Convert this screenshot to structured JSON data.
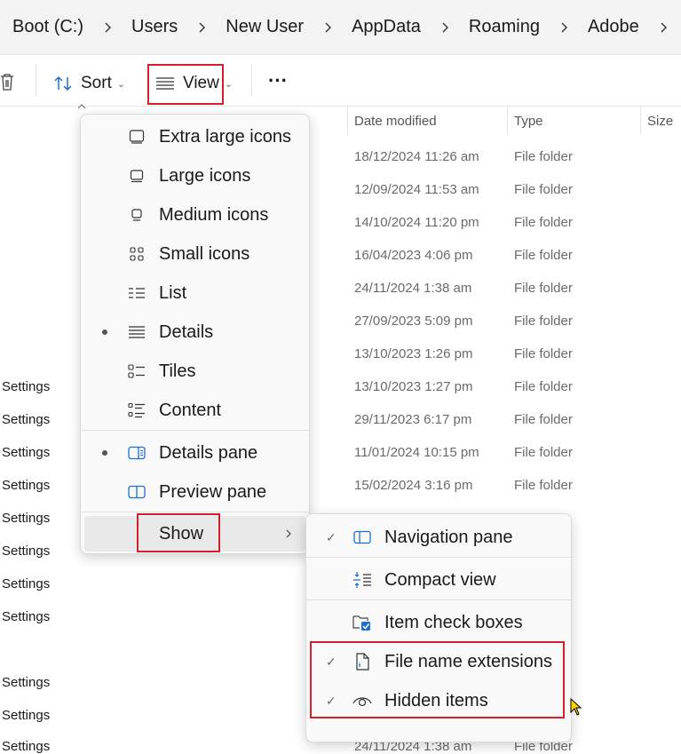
{
  "breadcrumb": [
    "Boot (C:)",
    "Users",
    "New User",
    "AppData",
    "Roaming",
    "Adobe"
  ],
  "toolbar": {
    "sort_label": "Sort",
    "view_label": "View",
    "more_label": "···"
  },
  "columns": {
    "date_modified": "Date modified",
    "type": "Type",
    "size": "Size"
  },
  "rows": [
    {
      "name": "",
      "date": "18/12/2024 11:26 am",
      "type": "File folder"
    },
    {
      "name": "",
      "date": "12/09/2024 11:53 am",
      "type": "File folder"
    },
    {
      "name": "",
      "date": "14/10/2024 11:20 pm",
      "type": "File folder"
    },
    {
      "name": "",
      "date": "16/04/2023 4:06 pm",
      "type": "File folder"
    },
    {
      "name": "",
      "date": "24/11/2024 1:38 am",
      "type": "File folder"
    },
    {
      "name": "",
      "date": "27/09/2023 5:09 pm",
      "type": "File folder"
    },
    {
      "name": "",
      "date": "13/10/2023 1:26 pm",
      "type": "File folder"
    },
    {
      "name": "Settings",
      "date": "13/10/2023 1:27 pm",
      "type": "File folder"
    },
    {
      "name": "Settings",
      "date": "29/11/2023 6:17 pm",
      "type": "File folder"
    },
    {
      "name": "Settings",
      "date": "11/01/2024 10:15 pm",
      "type": "File folder"
    },
    {
      "name": "Settings",
      "date": "15/02/2024 3:16 pm",
      "type": "File folder"
    },
    {
      "name": "Settings",
      "date": "",
      "type": ""
    },
    {
      "name": "Settings",
      "date": "",
      "type": ""
    },
    {
      "name": "Settings",
      "date": "",
      "type": ""
    },
    {
      "name": "Settings",
      "date": "",
      "type": ""
    },
    {
      "name": "",
      "date": "",
      "type": ""
    },
    {
      "name": "Settings",
      "date": "",
      "type": ""
    },
    {
      "name": "Settings",
      "date": "",
      "type": ""
    },
    {
      "name": "Settings",
      "date": "24/11/2024 1:38 am",
      "type": "File folder"
    }
  ],
  "view_menu": {
    "items": [
      {
        "label": "Extra large icons",
        "icon": "monitor-xl-icon",
        "selected": false
      },
      {
        "label": "Large icons",
        "icon": "monitor-l-icon",
        "selected": false
      },
      {
        "label": "Medium icons",
        "icon": "monitor-m-icon",
        "selected": false
      },
      {
        "label": "Small icons",
        "icon": "grid-icon",
        "selected": false
      },
      {
        "label": "List",
        "icon": "list-icon",
        "selected": false
      },
      {
        "label": "Details",
        "icon": "details-icon",
        "selected": true
      },
      {
        "label": "Tiles",
        "icon": "tiles-icon",
        "selected": false
      },
      {
        "label": "Content",
        "icon": "content-icon",
        "selected": false
      },
      {
        "label": "Details pane",
        "icon": "details-pane-icon",
        "selected": true
      },
      {
        "label": "Preview pane",
        "icon": "preview-pane-icon",
        "selected": false
      }
    ],
    "show_label": "Show"
  },
  "show_menu": {
    "items": [
      {
        "label": "Navigation pane",
        "icon": "navigation-pane-icon",
        "checked": true
      },
      {
        "label": "Compact view",
        "icon": "compact-view-icon",
        "checked": false
      },
      {
        "label": "Item check boxes",
        "icon": "checkbox-icon",
        "checked": false
      },
      {
        "label": "File name extensions",
        "icon": "file-icon",
        "checked": true
      },
      {
        "label": "Hidden items",
        "icon": "eye-icon",
        "checked": true
      }
    ]
  },
  "colors": {
    "highlight_box": "#d4202a",
    "checkbox_accent": "#1a6fd1"
  }
}
